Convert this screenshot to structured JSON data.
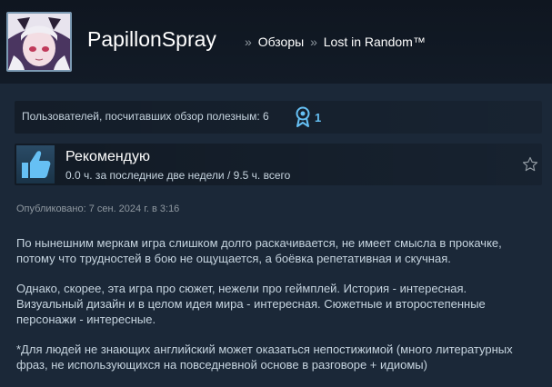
{
  "header": {
    "username": "PapillonSpray",
    "breadcrumb": {
      "separator": "»",
      "reviews": "Обзоры",
      "game": "Lost in Random™"
    }
  },
  "helpful": {
    "text": "Пользователей, посчитавших обзор полезным: 6",
    "award_icon": "award-ribbon-icon",
    "award_count": "1"
  },
  "verdict": {
    "title": "Рекомендую",
    "hours": "0.0 ч. за последние две недели / 9.5 ч. всего",
    "thumb_icon": "thumbs-up-icon"
  },
  "posted": "Опубликовано: 7 сен. 2024 г. в 3:16",
  "body": {
    "paragraphs": [
      "По нынешним меркам игра слишком долго раскачивается, не имеет смысла в прокачке, потому что трудностей в бою не ощущается, а боёвка репетативная и скучная.",
      "Однако, скорее, эта игра про сюжет, нежели про геймплей. История - интересная. Визуальный дизайн и в целом идея мира - интересная. Сюжетные и второстепенные персонажи - интересные.",
      "*Для людей не знающих английский может оказаться непостижимой (много литературных фраз, не использующихся на повседневной основе в разговоре + идиомы)"
    ]
  },
  "colors": {
    "background": "#1b2838",
    "link_blue": "#66c0f4",
    "text": "#c6d4df",
    "muted": "#8f98a0"
  }
}
